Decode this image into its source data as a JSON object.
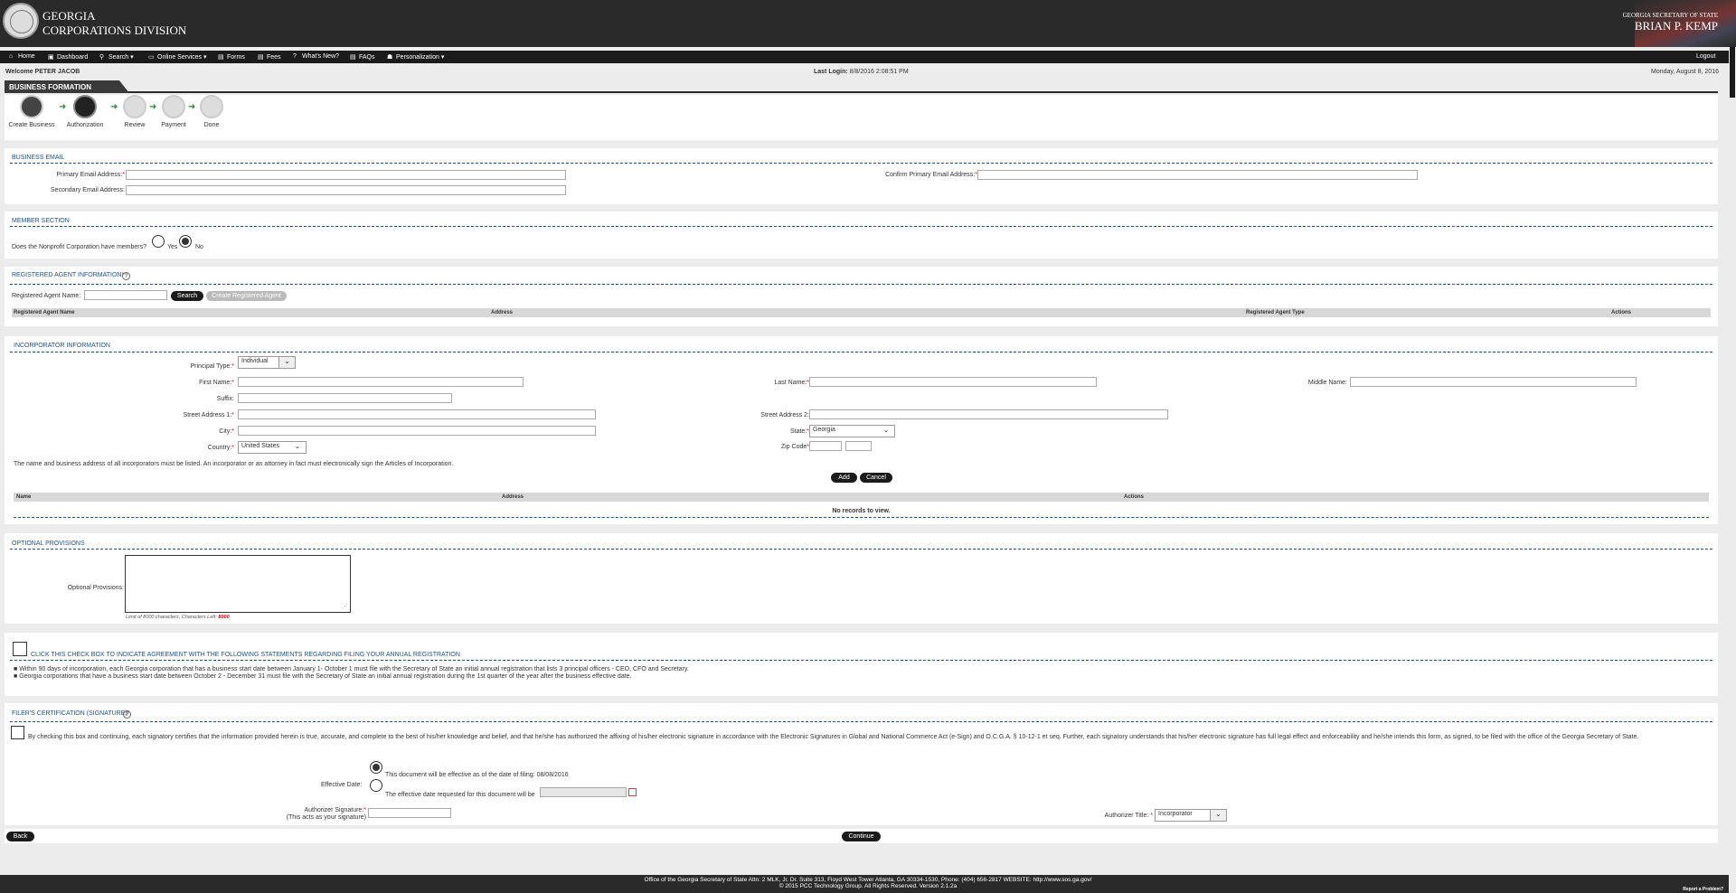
{
  "header": {
    "title_line1": "GEORGIA",
    "title_line2": "CORPORATIONS DIVISION",
    "sos_label": "GEORGIA SECRETARY OF STATE",
    "sos_name": "BRIAN P. KEMP"
  },
  "nav": {
    "items": [
      {
        "label": "Home",
        "icon": "home-icon"
      },
      {
        "label": "Dashboard",
        "icon": "dashboard-icon"
      },
      {
        "label": "Search",
        "icon": "search-icon",
        "dropdown": true
      },
      {
        "label": "Online Services",
        "icon": "monitor-icon",
        "dropdown": true
      },
      {
        "label": "Forms",
        "icon": "document-icon"
      },
      {
        "label": "Fees",
        "icon": "document-icon"
      },
      {
        "label": "What's New?",
        "icon": "question-icon"
      },
      {
        "label": "FAQs",
        "icon": "document-icon"
      },
      {
        "label": "Personalization",
        "icon": "user-icon",
        "dropdown": true
      }
    ],
    "logout": "Logout"
  },
  "topbar": {
    "welcome": "Welcome PETER JACOB",
    "last_login_label": "Last Login:",
    "last_login_value": "8/8/2016 2:08:51 PM",
    "date": "Monday, August 8, 2016"
  },
  "page": {
    "section_tab": "BUSINESS FORMATION"
  },
  "wizard": {
    "steps": [
      "Create Business",
      "Authorization",
      "Review",
      "Payment",
      "Done"
    ],
    "active_index": 1
  },
  "business_email": {
    "title": "BUSINESS EMAIL",
    "primary_label": "Primary Email Address:",
    "secondary_label": "Secondary Email Address:",
    "confirm_label": "Confirm Primary Email Address:",
    "required_mark": "*"
  },
  "member": {
    "title": "MEMBER SECTION",
    "question": "Does the Nonprofit Corporation have members?",
    "yes": "Yes",
    "no": "No",
    "selected": "No"
  },
  "agent": {
    "title": "REGISTERED AGENT INFORMATION",
    "name_label": "Registered Agent Name:",
    "search_btn": "Search",
    "create_btn": "Create Registered Agent",
    "columns": [
      "Registered Agent Name",
      "Address",
      "Registered Agent Type",
      "Actions"
    ]
  },
  "incorporator": {
    "title": "INCORPORATOR INFORMATION",
    "principal_type_label": "Principal Type:",
    "principal_type_value": "Individual",
    "first_name_label": "First Name:",
    "last_name_label": "Last Name:",
    "middle_name_label": "Middle Name:",
    "suffix_label": "Suffix:",
    "street1_label": "Street Address 1:",
    "street2_label": "Street Address 2:",
    "city_label": "City:",
    "state_label": "State:",
    "state_value": "Georgia",
    "country_label": "Country:",
    "country_value": "United States",
    "zip_label": "Zip Code",
    "note": "The name and business address of all incorporators must be listed. An incorporator or an attorney in fact must electronically sign the Articles of Incorporation.",
    "add_btn": "Add",
    "cancel_btn": "Cancel",
    "columns": [
      "Name",
      "Address",
      "Actions"
    ],
    "empty": "No records to view."
  },
  "optional": {
    "title": "OPTIONAL PROVISIONS",
    "label": "Optional Provisions:",
    "limit_text": "Limit of 8000 characters, Characters Left:",
    "chars_left": "8000"
  },
  "annual": {
    "title": "CLICK THIS CHECK BOX TO INDICATE AGREEMENT WITH THE FOLLOWING STATEMENTS REGARDING FILING YOUR ANNUAL REGISTRATION",
    "bullet1": "Within 90 days of incorporation, each Georgia corporation that has a business start date between January 1- October 1 must file with the Secretary of State an initial annual registration that lists 3 principal officers - CEO, CFO and Secretary.",
    "bullet2": "Georgia corporations that have a business start date between October 2 - December 31 must file with the Secretary of State an initial annual registration during the 1st quarter of the year after the business effective date."
  },
  "filer": {
    "title": "FILER'S CERTIFICATION (SIGNATURE)",
    "statement": "By checking this box and continuing, each signatory certifies that the information provided herein is true, accurate, and complete to the best of his/her knowledge and belief, and that he/she has authorized the affixing of his/her electronic signature in accordance with the Electronic Signatures in Global and National Commerce Act (e-Sign) and O.C.G.A. § 10-12-1 et seq. Further, each signatory understands that his/her electronic signature has full legal effect and enforceability and he/she intends this form, as signed, to be filed with the office of the Georgia Secretary of State.",
    "effective_label": "Effective Date:",
    "option1": "This document will be effective as of the date of filing: 08/08/2016",
    "option2": "The effective date requested for this document will be",
    "sig_label": "Authorizer Signature:",
    "sig_sub": "(This acts as your signature)",
    "title_label": "Authorizer Title:",
    "title_value": "Incorporator"
  },
  "actions": {
    "back": "Back",
    "continue": "Continue"
  },
  "footer": {
    "line1": "Office of the Georgia Secretary of State Attn: 2 MLK, Jr. Dr. Suite 313, Floyd West Tower Atlanta, GA 30334-1530, Phone: (404) 656-2817 WEBSITE: http://www.sos.ga.gov/",
    "line2": "© 2015 PCC Technology Group. All Rights Reserved. Version 2.1.2a",
    "report": "Report a Problem?"
  }
}
